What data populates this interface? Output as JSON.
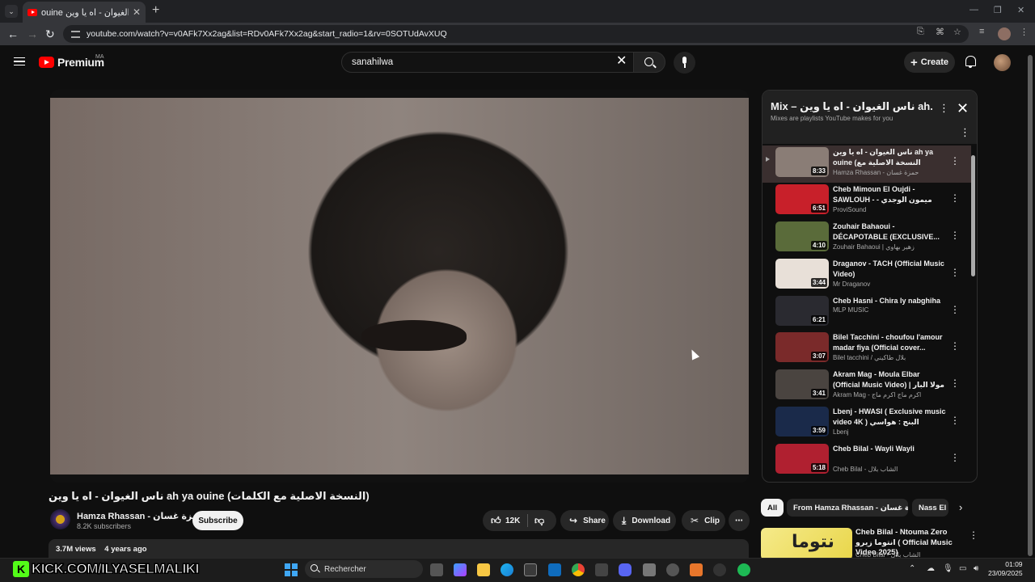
{
  "browser": {
    "tab_title": "ouine ناس الغيوان - اه يا وين",
    "new_tab": "+",
    "url": "youtube.com/watch?v=v0AFk7Xx2ag&list=RDv0AFk7Xx2ag&start_radio=1&rv=0SOTUdAvXUQ"
  },
  "header": {
    "logo": "Premium",
    "country": "MA",
    "search_value": "sanahilwa",
    "create_label": "Create"
  },
  "video": {
    "title": "ناس الغيوان - اه يا وين ah ya ouine (النسخة الاصلية مع الكلمات)",
    "channel": "Hamza Rhassan - حمزة غسان",
    "subscribers": "8.2K subscribers",
    "subscribe_label": "Subscribe",
    "likes": "12K",
    "share_label": "Share",
    "download_label": "Download",
    "clip_label": "Clip",
    "views": "3.7M views",
    "age": "4 years ago"
  },
  "playlist": {
    "title": "Mix – ناس الغيوان - اه يا وين ah...",
    "subtitle": "Mixes are playlists YouTube makes for you",
    "items": [
      {
        "title": "ناس الغيوان - اه يا وين ah ya ouine (النسخة الاصلية مع الكلمات)",
        "channel": "Hamza Rhassan - حمزة غسان",
        "duration": "8:33",
        "color": "#8a7d76"
      },
      {
        "title": "Cheb Mimoun El Oujdi - SAWLOUH - ميمون الوجدي - سولوه",
        "channel": "ProviSound",
        "duration": "6:51",
        "color": "#c8202a"
      },
      {
        "title": "Zouhair Bahaoui - DÉCAPOTABLE (EXCLUSIVE...",
        "channel": "Zouhair Bahaoui | زهير بهاوي",
        "duration": "4:10",
        "color": "#5a6b3a"
      },
      {
        "title": "Draganov - TACH (Official Music Video)",
        "channel": "Mr Draganov",
        "duration": "3:44",
        "color": "#e8e0d8"
      },
      {
        "title": "Cheb Hasni - Chira ly nabghiha",
        "channel": "MLP MUSIC",
        "duration": "6:21",
        "color": "#2a2a30"
      },
      {
        "title": "Bilel Tacchini - choufou l'amour madar fiya (Official cover...",
        "channel": "Bilel tacchini / بلال طاكيني",
        "duration": "3:07",
        "color": "#7a2a2a"
      },
      {
        "title": "Akram Mag - Moula Elbar (Official Music Video) | مولا البار",
        "channel": "Akram Mag - اكرم ماج اكرم ماج",
        "duration": "3:41",
        "color": "#4a4440"
      },
      {
        "title": "Lbenj - HWASI ( Exclusive music video 4K ) البنج : هواسي",
        "channel": "Lbenj",
        "duration": "3:59",
        "color": "#1a2a4a"
      },
      {
        "title": "Cheb Bilal - Wayli Wayli",
        "channel": "Cheb Bilal - الشاب بلال",
        "duration": "5:18",
        "color": "#b02030"
      }
    ]
  },
  "chips": [
    "All",
    "From Hamza Rhassan - حمزة غسان",
    "Nass El"
  ],
  "recommendation": {
    "title": "Cheb Bilal - Ntouma Zero انتوما زيرو ( Official Music Video 2025)",
    "channel": "Cheb Bilal - الشاب بلال",
    "thumb_text": "نتوما"
  },
  "overlay": {
    "kick_text": "KICK.COM/ILYASELMALIKI"
  },
  "taskbar": {
    "search_placeholder": "Rechercher",
    "time": "01:09",
    "date": "23/09/2025"
  }
}
